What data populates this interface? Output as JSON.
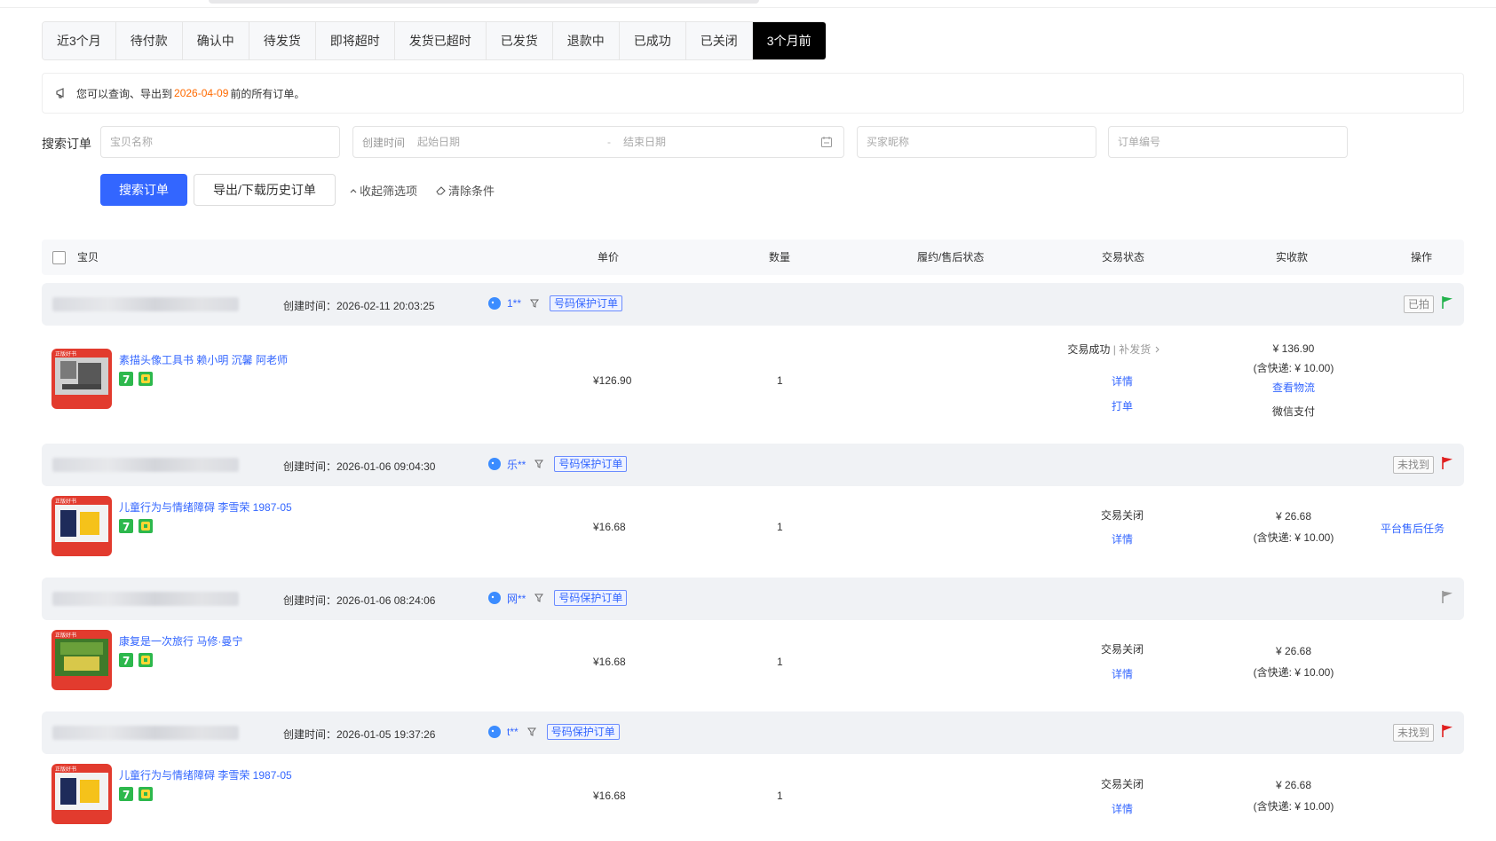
{
  "tabs": [
    "近3个月",
    "待付款",
    "确认中",
    "待发货",
    "即将超时",
    "发货已超时",
    "已发货",
    "退款中",
    "已成功",
    "已关闭",
    "3个月前"
  ],
  "notice": {
    "pre": "您可以查询、导出到",
    "date": "2026-04-09",
    "post": "前的所有订单。"
  },
  "search": {
    "label": "搜索订单",
    "product_placeholder": "宝贝名称",
    "created_label": "创建时间",
    "start_placeholder": "起始日期",
    "range_sep": "-",
    "end_placeholder": "结束日期",
    "buyer_placeholder": "买家昵称",
    "order_placeholder": "订单编号",
    "search_button": "搜索订单",
    "export_button": "导出/下载历史订单",
    "collapse_link": "收起筛选项",
    "clear_link": "清除条件"
  },
  "table_header": {
    "product": "宝贝",
    "unit_price": "单价",
    "quantity": "数量",
    "fulfil_status": "履约/售后状态",
    "trade_status": "交易状态",
    "amount": "实收款",
    "action": "操作"
  },
  "orders": [
    {
      "created": "创建时间：2026-02-11 20:03:25",
      "buyer": "1**",
      "tag": "号码保护订单",
      "mark": "已拍",
      "flag_color": "#22b24c",
      "product": "素描头像工具书 赖小明 沉馨 阿老师",
      "price": "¥126.90",
      "qty": "1",
      "status": "交易成功",
      "status_extra": "| 补发货",
      "detail": "详情",
      "print": "打单",
      "amount": "¥ 136.90",
      "shipping": "(含快递: ¥ 10.00)",
      "logistics": "查看物流",
      "payment": "微信支付",
      "action": ""
    },
    {
      "created": "创建时间：2026-01-06 09:04:30",
      "buyer": "乐**",
      "tag": "号码保护订单",
      "mark": "未找到",
      "flag_color": "#e02020",
      "product": "儿童行为与情绪障碍 李雪荣 1987-05",
      "price": "¥16.68",
      "qty": "1",
      "status": "交易关闭",
      "detail": "详情",
      "amount": "¥ 26.68",
      "shipping": "(含快递: ¥ 10.00)",
      "action": "平台售后任务"
    },
    {
      "created": "创建时间：2026-01-06 08:24:06",
      "buyer": "网**",
      "tag": "号码保护订单",
      "mark": "",
      "flag_color": "#999999",
      "product": "康复是一次旅行 马修·曼宁",
      "price": "¥16.68",
      "qty": "1",
      "status": "交易关闭",
      "detail": "详情",
      "amount": "¥ 26.68",
      "shipping": "(含快递: ¥ 10.00)",
      "action": ""
    },
    {
      "created": "创建时间：2026-01-05 19:37:26",
      "buyer": "t**",
      "tag": "号码保护订单",
      "mark": "未找到",
      "flag_color": "#e02020",
      "product": "儿童行为与情绪障碍 李雪荣 1987-05",
      "price": "¥16.68",
      "qty": "1",
      "status": "交易关闭",
      "detail": "详情",
      "amount": "¥ 26.68",
      "shipping": "(含快递: ¥ 10.00)",
      "action": ""
    }
  ],
  "colors": {
    "primary": "#3366ff",
    "highlight": "#ff6a00",
    "active_tab": "#000000"
  }
}
